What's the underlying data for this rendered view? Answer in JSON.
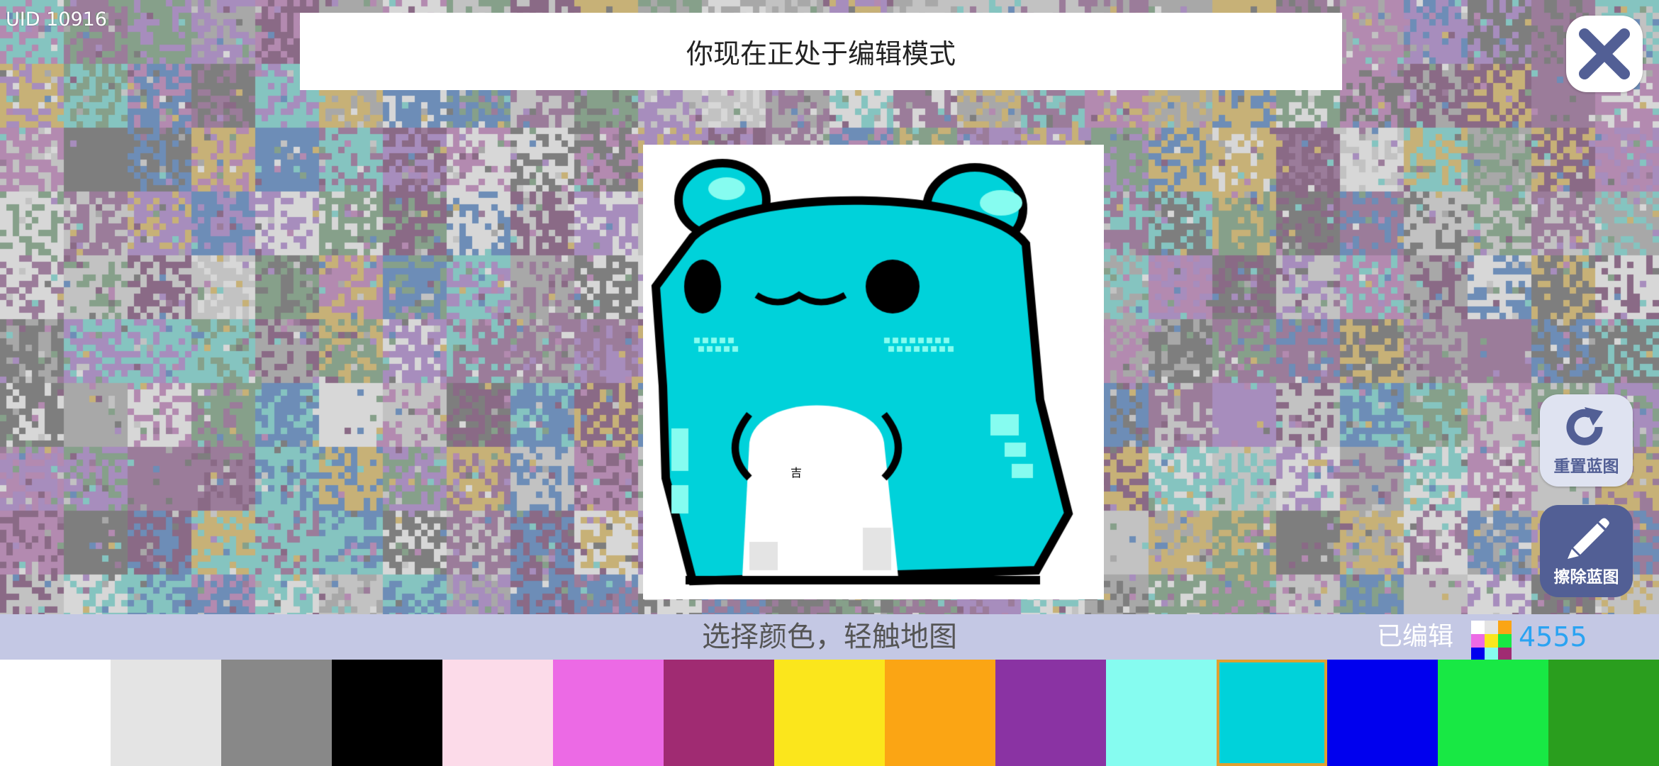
{
  "uid": "UID 10916",
  "banner": {
    "text": "你现在正处于编辑模式"
  },
  "close": {
    "icon": "close-icon"
  },
  "blueprint": {
    "glyph": "吉"
  },
  "buttons": {
    "reset": {
      "label": "重置蓝图",
      "icon": "refresh-icon"
    },
    "erase": {
      "label": "擦除蓝图",
      "icon": "pencil-icon"
    }
  },
  "status": {
    "hint": "选择颜色，轻触地图",
    "edited_label": "已编辑",
    "edited_count": "4555"
  },
  "palette": {
    "selected_index": 11,
    "colors": [
      "#ffffff",
      "#e4e4e4",
      "#888888",
      "#000000",
      "#fcdbe9",
      "#ec6ae5",
      "#a02b72",
      "#fbe61c",
      "#fba514",
      "#8a33a3",
      "#86fcf0",
      "#00d2da",
      "#0000ee",
      "#18e844",
      "#2a9e1e"
    ]
  },
  "map": {
    "colors": [
      "#7e7e7e",
      "#a8a8a8",
      "#c2c2c2",
      "#b38ab0",
      "#9b7c9a",
      "#86a08a",
      "#c7b177",
      "#85c4c0",
      "#a78dbd",
      "#d7d7d7",
      "#8a6a86",
      "#6d8db7"
    ]
  },
  "frog_colors": {
    "outline": "#000000",
    "body": "#00d2da",
    "light": "#86fcf0",
    "belly": "#ffffff",
    "belly_shade": "#e4e4e4"
  }
}
